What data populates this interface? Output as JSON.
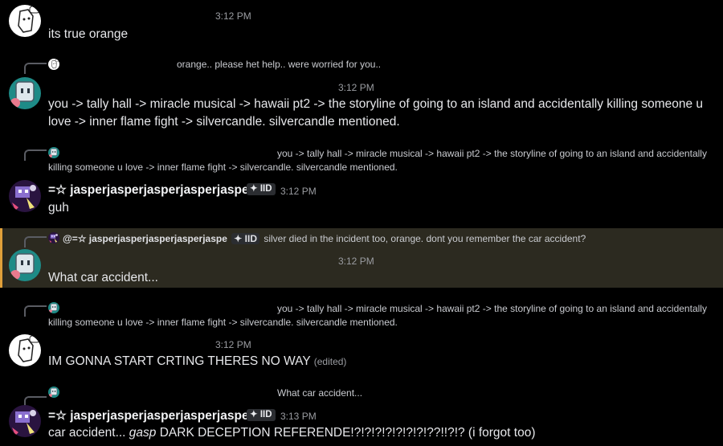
{
  "messages": [
    {
      "time": "3:12 PM",
      "text": "its true orange"
    },
    {
      "reply": "orange.. please het help.. were worried for you..",
      "time": "3:12 PM",
      "text": "you -> tally hall -> miracle musical -> hawaii pt2 -> the storyline of going to an island and accidentally killing someone u love -> inner flame fight -> silvercandle. silvercandle mentioned."
    },
    {
      "reply": "you -> tally hall -> miracle musical -> hawaii pt2 -> the storyline of going to an island and accidentally killing someone u love -> inner flame fight -> silvercandle. silvercandle mentioned.",
      "author": "=☆ jasperjasperjasperjasperjaspe",
      "tag": "✦ IID",
      "time": "3:12 PM",
      "text": "guh"
    },
    {
      "reply_author": "@=☆ jasperjasperjasperjasperjaspe",
      "reply_tag": "✦ IID",
      "reply": "silver died in the incident too, orange. dont you remember the car accident?",
      "time": "3:12 PM",
      "text": "What car accident..."
    },
    {
      "reply": "you -> tally hall -> miracle musical -> hawaii pt2 -> the storyline of going to an island and accidentally killing someone u love -> inner flame fight -> silvercandle. silvercandle mentioned.",
      "time": "3:12 PM",
      "text": "IM GONNA START CRTING THERES NO WAY",
      "edited": "(edited)"
    },
    {
      "reply": "What car accident...",
      "author": "=☆ jasperjasperjasperjasperjaspe",
      "tag": "✦ IID",
      "time": "3:13 PM",
      "text_pre": "car accident... ",
      "text_em": "gasp",
      "text_post": " DARK DECEPTION REFERENDE!?!?!?!?!?!?!?!??!!?!? (i forgot too)"
    }
  ]
}
